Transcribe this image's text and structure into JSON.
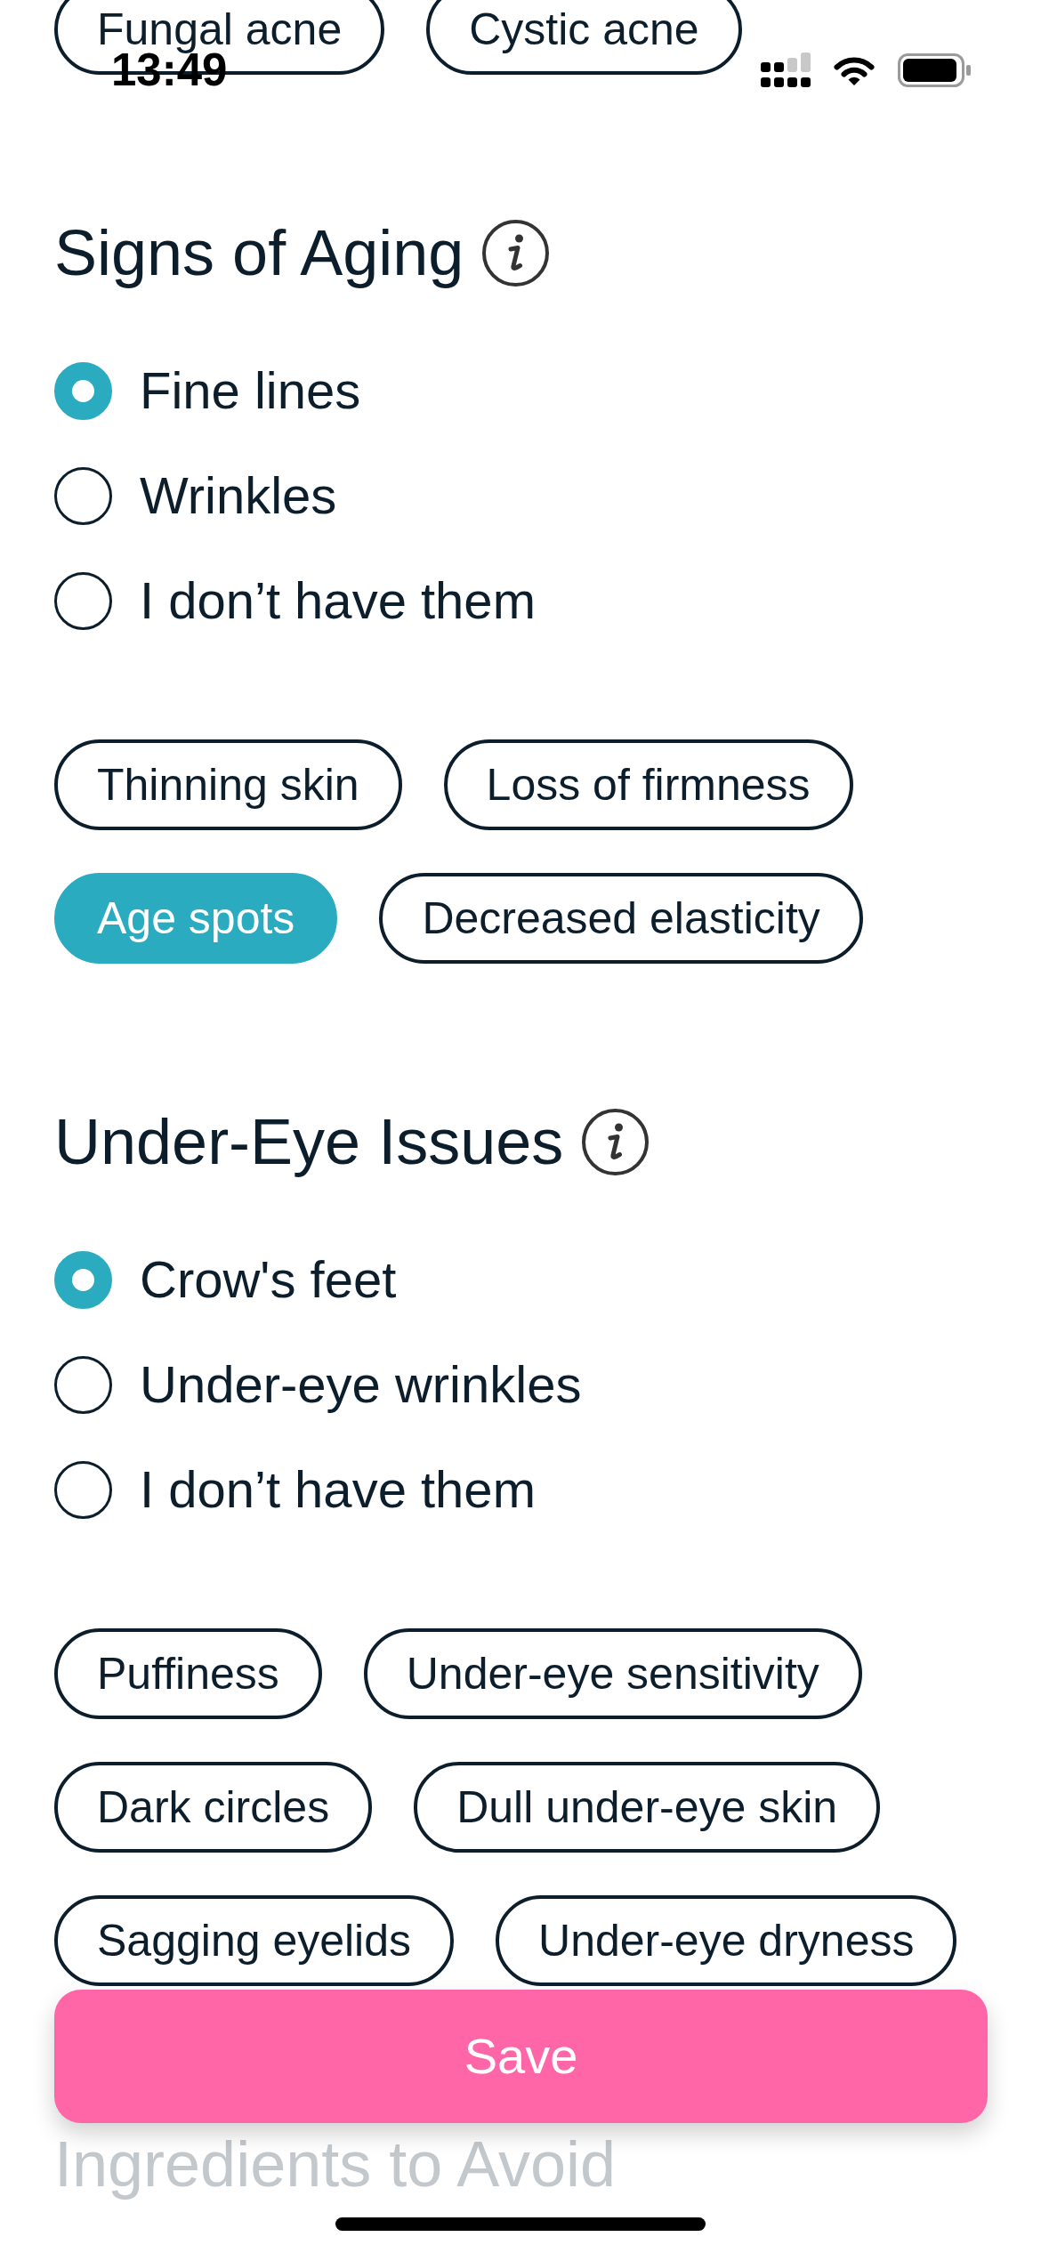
{
  "status_bar": {
    "time": "13:49"
  },
  "previous_section": {
    "tags": [
      {
        "label": "Fungal acne",
        "selected": false
      },
      {
        "label": "Cystic acne",
        "selected": false
      }
    ]
  },
  "sections": [
    {
      "title": "Signs of Aging",
      "options": [
        {
          "label": "Fine lines",
          "selected": true
        },
        {
          "label": "Wrinkles",
          "selected": false
        },
        {
          "label": "I don’t have them",
          "selected": false
        }
      ],
      "tags": [
        {
          "label": "Thinning skin",
          "selected": false
        },
        {
          "label": "Loss of firmness",
          "selected": false
        },
        {
          "label": "Age spots",
          "selected": true
        },
        {
          "label": "Decreased elasticity",
          "selected": false
        }
      ]
    },
    {
      "title": "Under-Eye Issues",
      "options": [
        {
          "label": "Crow's feet",
          "selected": true
        },
        {
          "label": "Under-eye wrinkles",
          "selected": false
        },
        {
          "label": "I don’t have them",
          "selected": false
        }
      ],
      "tags": [
        {
          "label": "Puffiness",
          "selected": false
        },
        {
          "label": "Under-eye sensitivity",
          "selected": false
        },
        {
          "label": "Dark circles",
          "selected": false
        },
        {
          "label": "Dull under-eye skin",
          "selected": false
        },
        {
          "label": "Sagging eyelids",
          "selected": false
        },
        {
          "label": "Under-eye dryness",
          "selected": false
        }
      ]
    }
  ],
  "save_button": {
    "label": "Save"
  },
  "next_section": {
    "title": "Ingredients to Avoid"
  }
}
